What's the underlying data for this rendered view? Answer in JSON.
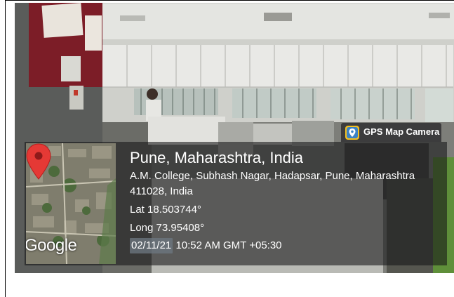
{
  "location": {
    "place_title": "Pune, Maharashtra, India",
    "address_line_1": "A.M. College, Subhash Nagar, Hadapsar, Pune, Maharashtra",
    "address_line_2": "411028, India",
    "latitude": "Lat 18.503744°",
    "longitude": "Long 73.95408°",
    "date": "02/11/21",
    "time": "10:52 AM GMT +05:30"
  },
  "map": {
    "provider_logo_text": "Google",
    "pin_color": "#e53935"
  },
  "badge": {
    "label": "GPS Map Camera",
    "icon_name": "gps-map-camera-icon"
  }
}
